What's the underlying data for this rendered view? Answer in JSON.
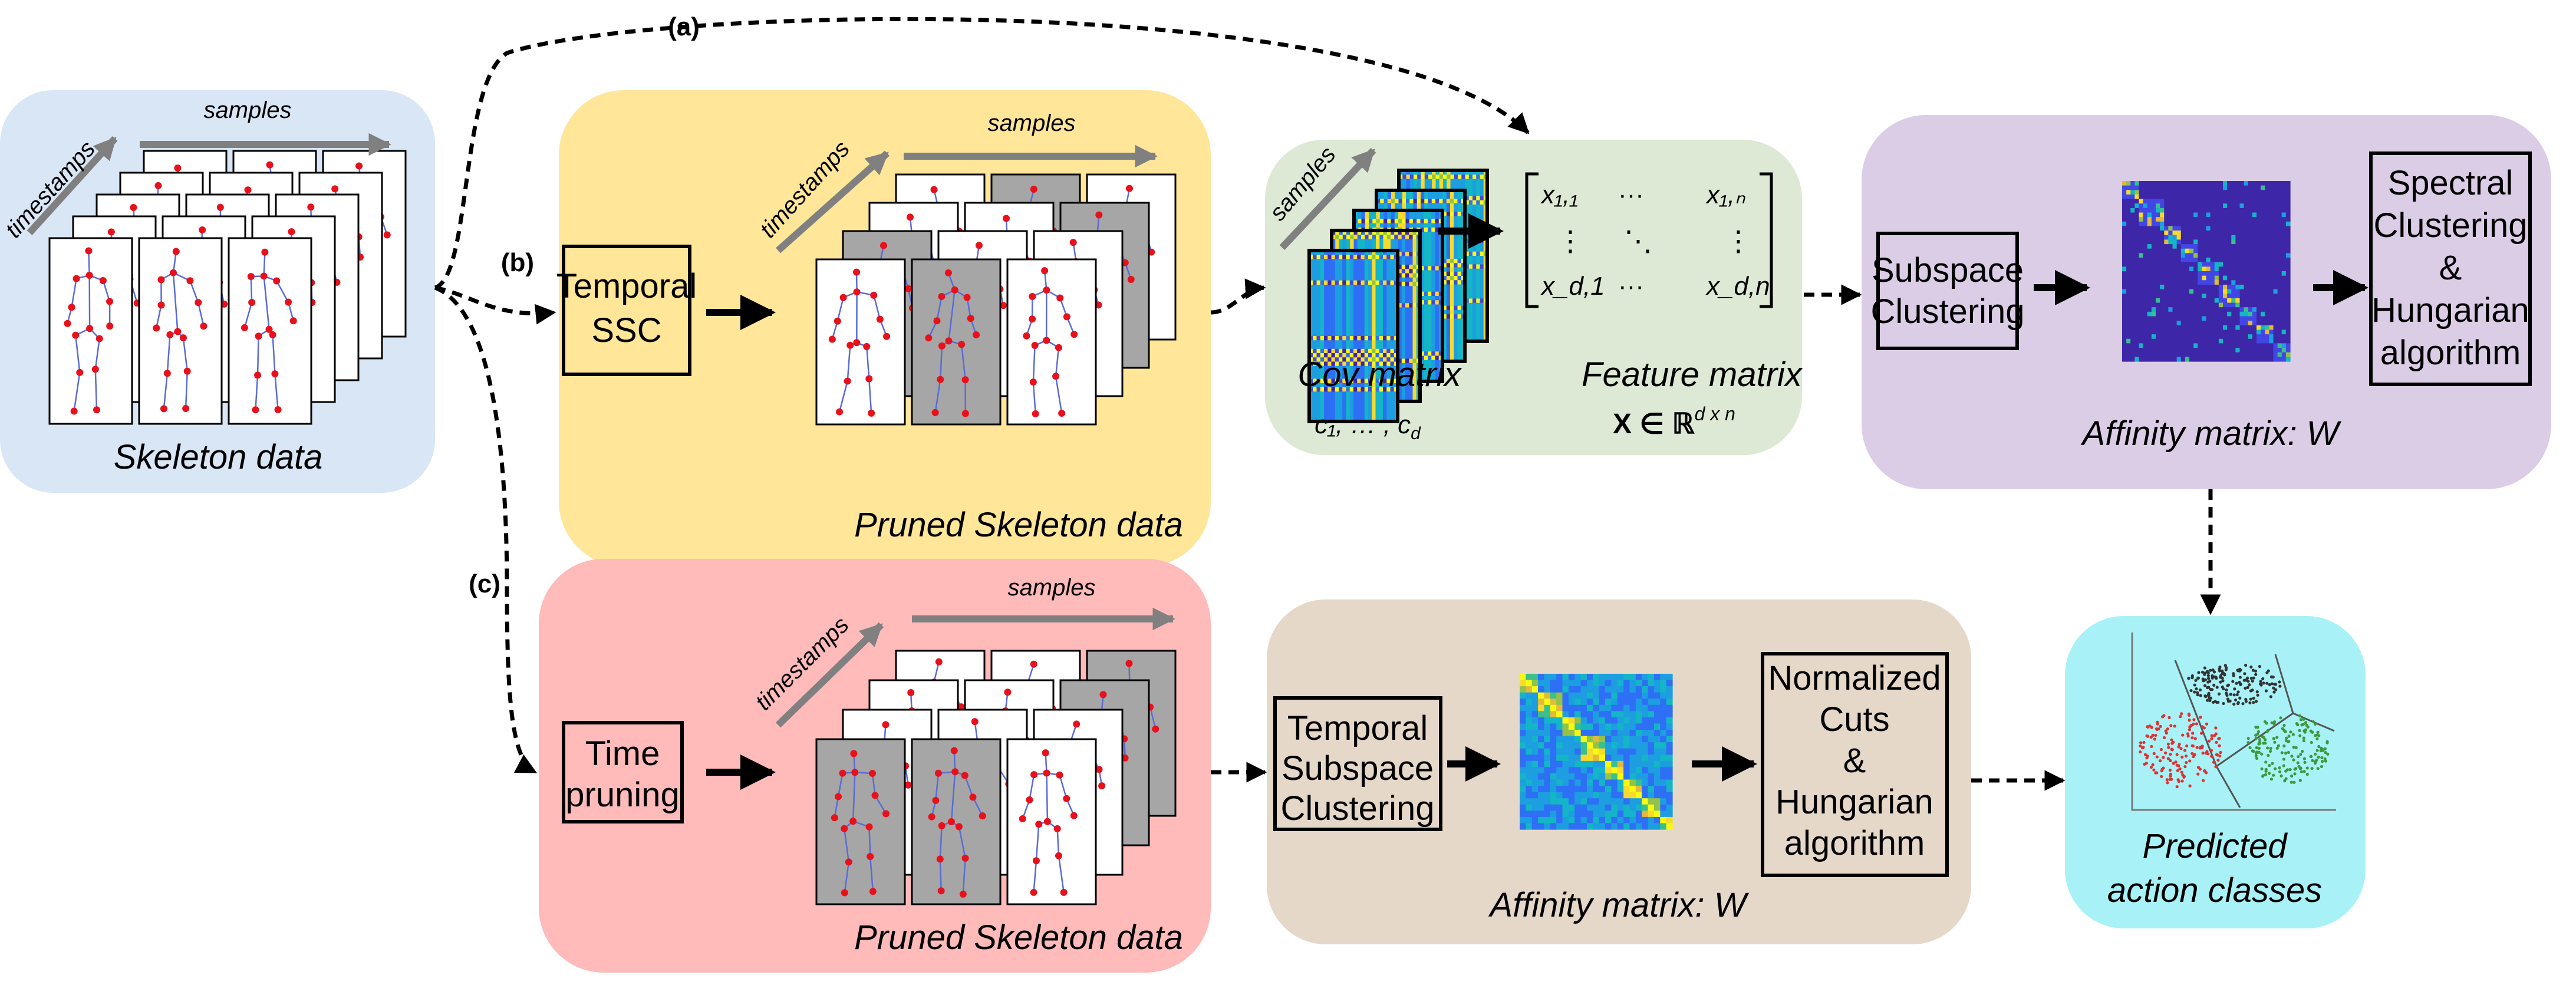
{
  "colors": {
    "skeleton_panel": "#d9e6f5",
    "pruned_panel_b": "#ffe699",
    "cov_panel": "#dee9d5",
    "affinity_panel_top": "#dccde7",
    "pruned_panel_c": "#ffbaba",
    "affinity_panel_bottom": "#e6d8c9",
    "prediction_panel": "#a8f2f7",
    "joint": "#e8101a",
    "bone": "#5a6bd6",
    "pruned_frame": "#a6a6a6",
    "axis_arrow": "#808080"
  },
  "paths": {
    "a": "(a)",
    "b": "(b)",
    "c": "(c)"
  },
  "skeleton_panel": {
    "samples": "samples",
    "timestamps": "timestamps",
    "caption": "Skeleton data"
  },
  "temporal_ssc_panel": {
    "step": [
      "Temporal",
      "SSC"
    ],
    "samples": "samples",
    "timestamps": "timestamps",
    "caption": "Pruned Skeleton data"
  },
  "time_pruning_panel": {
    "step": [
      "Time",
      "pruning"
    ],
    "samples": "samples",
    "timestamps": "timestamps",
    "caption": "Pruned Skeleton data"
  },
  "feature_panel": {
    "samples": "samples",
    "cov_caption": "Cov matrix",
    "cov_sub": "c₁, … , c",
    "cov_sub_end": "d",
    "matrix": {
      "r1c1": "x₁,₁",
      "r1dots": "···",
      "r1cn": "x₁,ₙ",
      "vdots": "⋮",
      "ddots": "⋱",
      "rdc1": "x_d,1",
      "rddots": "···",
      "rdcn": "x_d,n"
    },
    "feature_caption": "Feature matrix",
    "feature_sub": "X ∈ ℝ",
    "feature_sup": "d x n"
  },
  "affinity_top_panel": {
    "step1": [
      "Subspace",
      "Clustering"
    ],
    "step2": [
      "Spectral",
      "Clustering",
      "&",
      "Hungarian",
      "algorithm"
    ],
    "caption": "Affinity matrix: W"
  },
  "affinity_bottom_panel": {
    "step1": [
      "Temporal",
      "Subspace",
      "Clustering"
    ],
    "step2": [
      "Normalized",
      "Cuts",
      "&",
      "Hungarian",
      "algorithm"
    ],
    "caption": "Affinity matrix: W"
  },
  "prediction_panel": {
    "caption": [
      "Predicted",
      "action classes"
    ]
  }
}
